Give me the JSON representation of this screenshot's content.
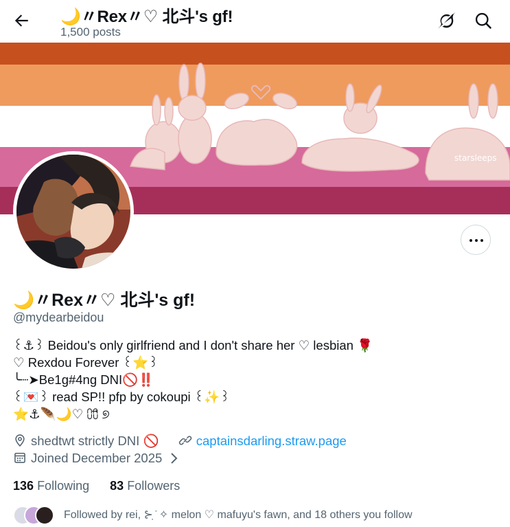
{
  "header": {
    "title": "🌙〃Rex〃♡ 北斗's gf!",
    "posts": "1,500 posts"
  },
  "banner": {
    "credit": "starsleeps",
    "colors": [
      "#c7501f",
      "#ee9a5c",
      "#ffffff",
      "#d46a9b",
      "#a8315e"
    ]
  },
  "profile": {
    "name": "🌙〃Rex〃♡ 北斗's gf!",
    "handle": "@mydearbeidou",
    "bio": [
      "꒰⚓꒱ Beidou's only girlfriend and I don't share her ♡ lesbian 🌹",
      "♡ Rexdou Forever ꒰⭐꒱",
      " ╰┈➤Be1g#4ng DNI🚫‼️",
      "꒰💌꒱ read SP!! pfp by cokoupi ꒰✨꒱",
      "⭐⚓🪶🌙♡ ⩇⩇⃗ ୭"
    ],
    "location": "shedtwt strictly DNI 🚫",
    "website": "captainsdarling.straw.page",
    "joined": "Joined December 2025",
    "following_count": "136",
    "following_label": "Following",
    "followers_count": "83",
    "followers_label": "Followers",
    "followed_by": "Followed by rei, ⊱ ̣̇ ✧ melon ♡ mafuyu's fawn, and 18 others you follow"
  },
  "icons": {
    "back": "back-arrow-icon",
    "grok": "grok-icon",
    "search": "search-icon",
    "more": "more-dots-icon",
    "location": "location-pin-icon",
    "link": "link-icon",
    "calendar": "calendar-icon",
    "chevron": "chevron-right-icon"
  }
}
